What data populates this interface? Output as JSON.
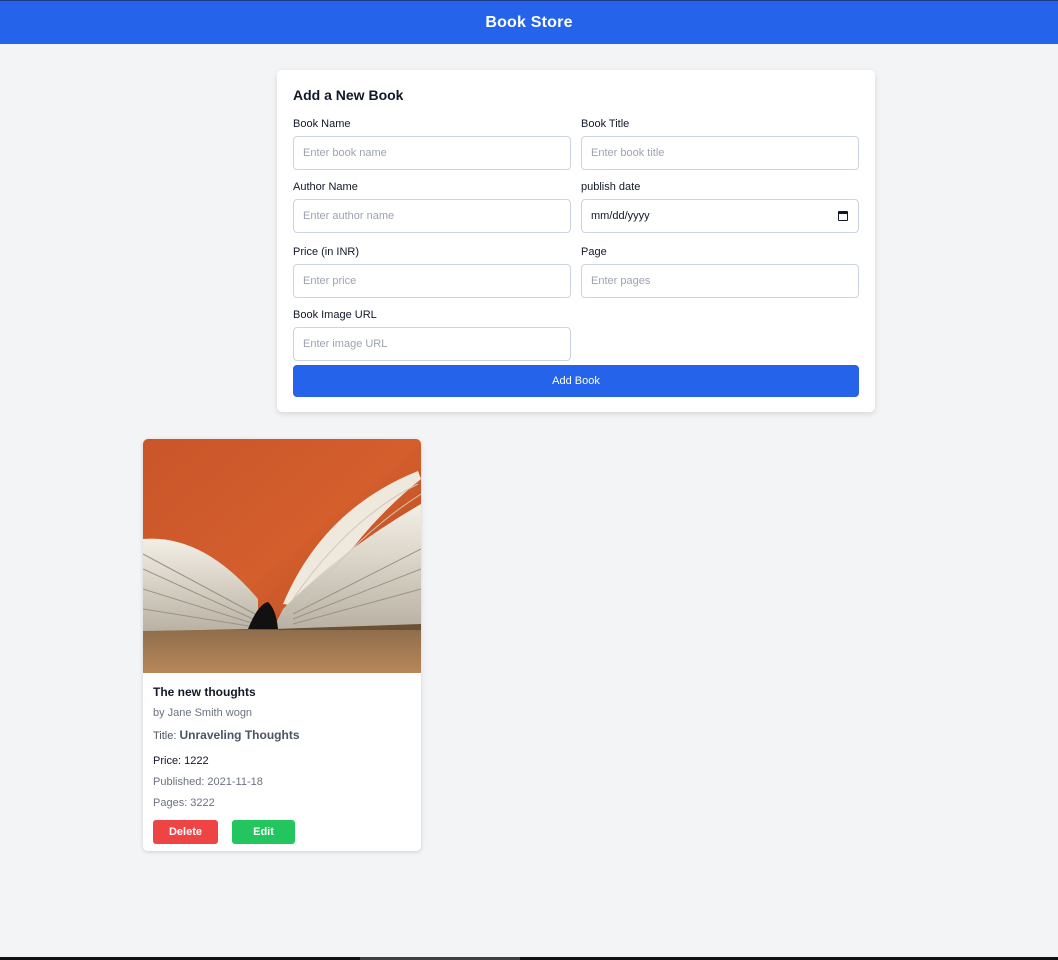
{
  "header": {
    "title": "Book Store"
  },
  "form": {
    "heading": "Add a New Book",
    "fields": {
      "book_name": {
        "label": "Book Name",
        "placeholder": "Enter book name",
        "value": ""
      },
      "book_title": {
        "label": "Book Title",
        "placeholder": "Enter book title",
        "value": ""
      },
      "author_name": {
        "label": "Author Name",
        "placeholder": "Enter author name",
        "value": ""
      },
      "publish_date": {
        "label": "publish date",
        "placeholder": "mm/dd/yyyy",
        "value": ""
      },
      "price": {
        "label": "Price (in INR)",
        "placeholder": "Enter price",
        "value": ""
      },
      "pages": {
        "label": "Page",
        "placeholder": "Enter pages",
        "value": ""
      },
      "image_url": {
        "label": "Book Image URL",
        "placeholder": "Enter image URL",
        "value": ""
      }
    },
    "submit_label": "Add Book"
  },
  "books": [
    {
      "name": "The new thoughts",
      "author_line": "by Jane Smith wogn",
      "title_prefix": "Title:",
      "title": "Unraveling Thoughts",
      "price_line": "Price: 1222",
      "published_line": "Published: 2021-11-18",
      "pages_line": "Pages: 3222",
      "delete_label": "Delete",
      "edit_label": "Edit"
    }
  ],
  "colors": {
    "primary": "#2563eb",
    "danger": "#ef4444",
    "success": "#22c55e",
    "background": "#f3f4f6"
  }
}
